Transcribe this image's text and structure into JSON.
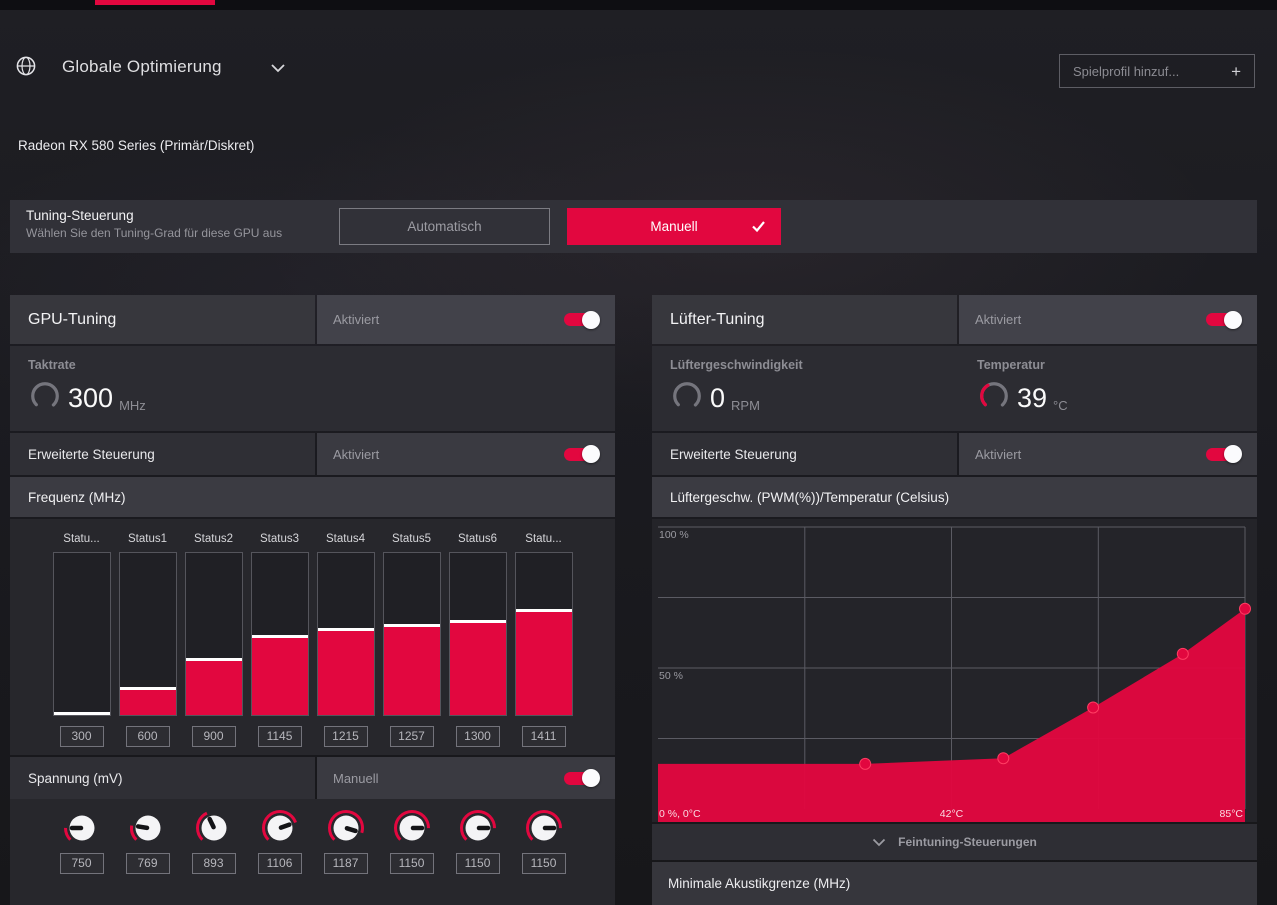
{
  "colors": {
    "accent": "#e2073f",
    "panel_dark": "#27272c",
    "panel_mid": "#2f2f35",
    "panel_light": "#3b3b42"
  },
  "header": {
    "title": "Globale Optimierung",
    "add_profile_label": "Spielprofil hinzuf...",
    "add_plus": "+"
  },
  "gpu_name": "Radeon RX 580 Series (Primär/Diskret)",
  "tuning_control": {
    "title": "Tuning-Steuerung",
    "subtitle": "Wählen Sie den Tuning-Grad für diese GPU aus",
    "auto_label": "Automatisch",
    "manual_label": "Manuell",
    "manual_selected": true
  },
  "gpu_tuning": {
    "title": "GPU-Tuning",
    "enabled_label": "Aktiviert",
    "enabled": true,
    "clock": {
      "label": "Taktrate",
      "value": "300",
      "unit": "MHz",
      "gauge_fraction": 0
    },
    "advanced_label": "Erweiterte Steuerung",
    "advanced_enabled_label": "Aktiviert",
    "advanced_enabled": true,
    "frequency_title": "Frequenz (MHz)",
    "voltage": {
      "title": "Spannung (mV)",
      "mode_label": "Manuell",
      "values": [
        750,
        769,
        893,
        1106,
        1187,
        1150,
        1150,
        1150
      ],
      "render_range": [
        650,
        1250
      ]
    }
  },
  "fan_tuning": {
    "title": "Lüfter-Tuning",
    "enabled_label": "Aktiviert",
    "enabled": true,
    "speed": {
      "label": "Lüftergeschwindigkeit",
      "value": "0",
      "unit": "RPM",
      "gauge_fraction": 0
    },
    "temp": {
      "label": "Temperatur",
      "value": "39",
      "unit": "°C",
      "gauge_fraction": 0.39
    },
    "advanced_label": "Erweiterte Steuerung",
    "advanced_enabled_label": "Aktiviert",
    "advanced_enabled": true,
    "fine_tuning_label": "Feintuning-Steuerungen",
    "min_acoustic_label": "Minimale Akustikgrenze (MHz)"
  },
  "chart_data": [
    {
      "type": "bar",
      "title": "Frequenz (MHz)",
      "categories": [
        "Statu...",
        "Status1",
        "Status2",
        "Status3",
        "Status4",
        "Status5",
        "Status6",
        "Statu..."
      ],
      "values": [
        300,
        600,
        900,
        1145,
        1215,
        1257,
        1300,
        1411
      ],
      "ylim": [
        300,
        2000
      ],
      "bar_color": "#e2073f"
    },
    {
      "type": "area",
      "title": "Lüftergeschw. (PWM(%))/Temperatur (Celsius)",
      "x": [
        0,
        30,
        50,
        63,
        76,
        85
      ],
      "y": [
        16,
        16,
        18,
        36,
        55,
        71
      ],
      "xlim": [
        0,
        85
      ],
      "ylim": [
        0,
        100
      ],
      "y_tick_labels": [
        "100 %",
        "50 %"
      ],
      "x_axis_labels": [
        "0 %, 0°C",
        "42°C",
        "85°C"
      ],
      "grid": true,
      "legend": false,
      "area_color": "#e2073f"
    }
  ]
}
